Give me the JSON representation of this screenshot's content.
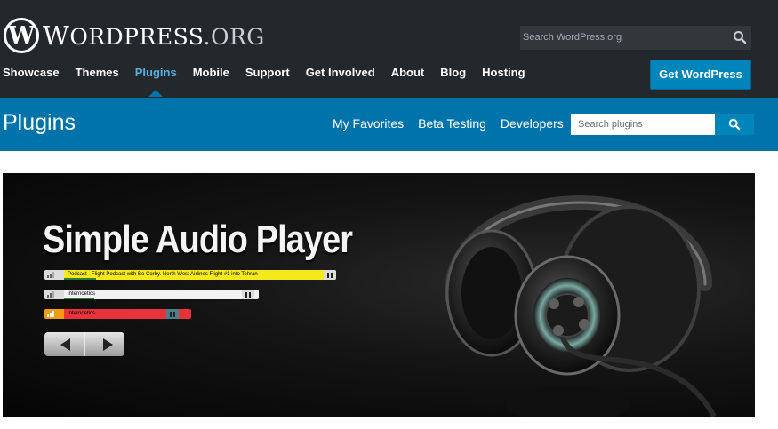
{
  "header": {
    "logo_mark": "W",
    "logo_text_w": "W",
    "logo_text_rest": "ORDPRESS",
    "logo_text_org": ".ORG",
    "search_placeholder": "Search WordPress.org",
    "nav": [
      "Showcase",
      "Themes",
      "Plugins",
      "Mobile",
      "Support",
      "Get Involved",
      "About",
      "Blog",
      "Hosting"
    ],
    "active_nav": "Plugins",
    "cta_label": "Get WordPress"
  },
  "subheader": {
    "title": "Plugins",
    "links": [
      "My Favorites",
      "Beta Testing",
      "Developers"
    ],
    "search_placeholder": "Search plugins"
  },
  "banner": {
    "title": "Simple Audio Player",
    "players": [
      {
        "label": "Podcast - Flight Podcast with Bo Corby. North West Airlines Flight #1 into Tehran",
        "color": "#f5e81b"
      },
      {
        "label": "Internoetics",
        "color": "#f2f2f2"
      },
      {
        "label": "Internoetics",
        "color": "#e8333a"
      }
    ]
  },
  "colors": {
    "header_bg": "#23282d",
    "accent_blue": "#0073aa",
    "active_link": "#59b0e0",
    "cta_bg": "#0085ba"
  }
}
